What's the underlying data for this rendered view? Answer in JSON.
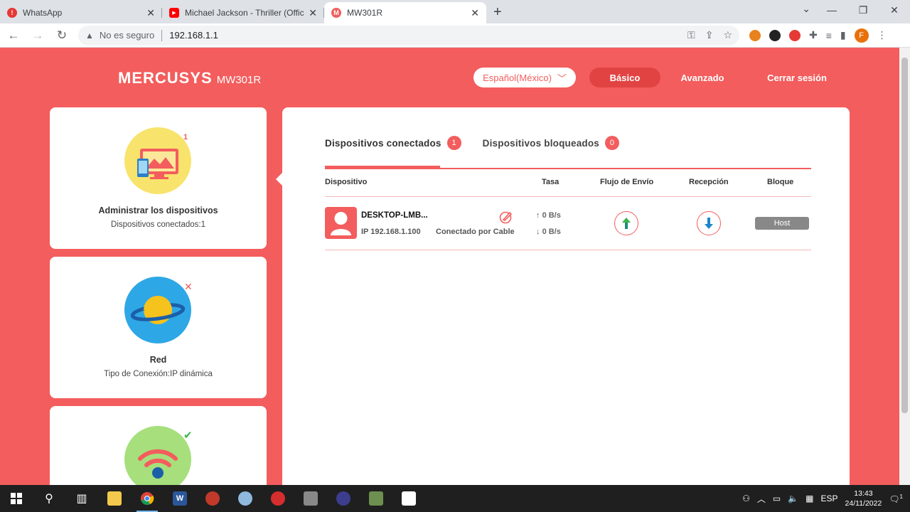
{
  "browser": {
    "tabs": [
      {
        "title": "WhatsApp",
        "color": "#e53935",
        "glyph": "!"
      },
      {
        "title": "Michael Jackson - Thriller (Officia",
        "color": "#ff0000",
        "glyph": "▶"
      },
      {
        "title": "MW301R",
        "color": "#f35d5d",
        "glyph": "M"
      }
    ],
    "url_warning": "No es seguro",
    "url": "192.168.1.1"
  },
  "header": {
    "brand": "MERCUSYS",
    "model": "MW301R",
    "language": "Español(México)",
    "nav": {
      "basic": "Básico",
      "advanced": "Avanzado",
      "logout": "Cerrar sesión"
    }
  },
  "cards": [
    {
      "title": "Administrar los dispositivos",
      "subtitle": "Dispositivos conectados:1",
      "badge": "1"
    },
    {
      "title": "Red",
      "subtitle": "Tipo de Conexión:IP dinámica"
    },
    {
      "title": "",
      "subtitle": ""
    }
  ],
  "panel": {
    "tabs": [
      {
        "label": "Dispositivos conectados",
        "count": "1"
      },
      {
        "label": "Dispositivos bloqueados",
        "count": "0"
      }
    ],
    "columns": {
      "device": "Dispositivo",
      "rate": "Tasa",
      "upload": "Flujo de Envío",
      "download": "Recepción",
      "block": "Bloque"
    },
    "devices": [
      {
        "name": "DESKTOP-LMB...",
        "ip": "IP 192.168.1.100",
        "connection": "Conectado por Cable",
        "up_rate": "0 B/s",
        "down_rate": "0 B/s",
        "block_label": "Host"
      }
    ]
  },
  "taskbar": {
    "language": "ESP",
    "time": "13:43",
    "date": "24/11/2022",
    "notifications": "1"
  }
}
